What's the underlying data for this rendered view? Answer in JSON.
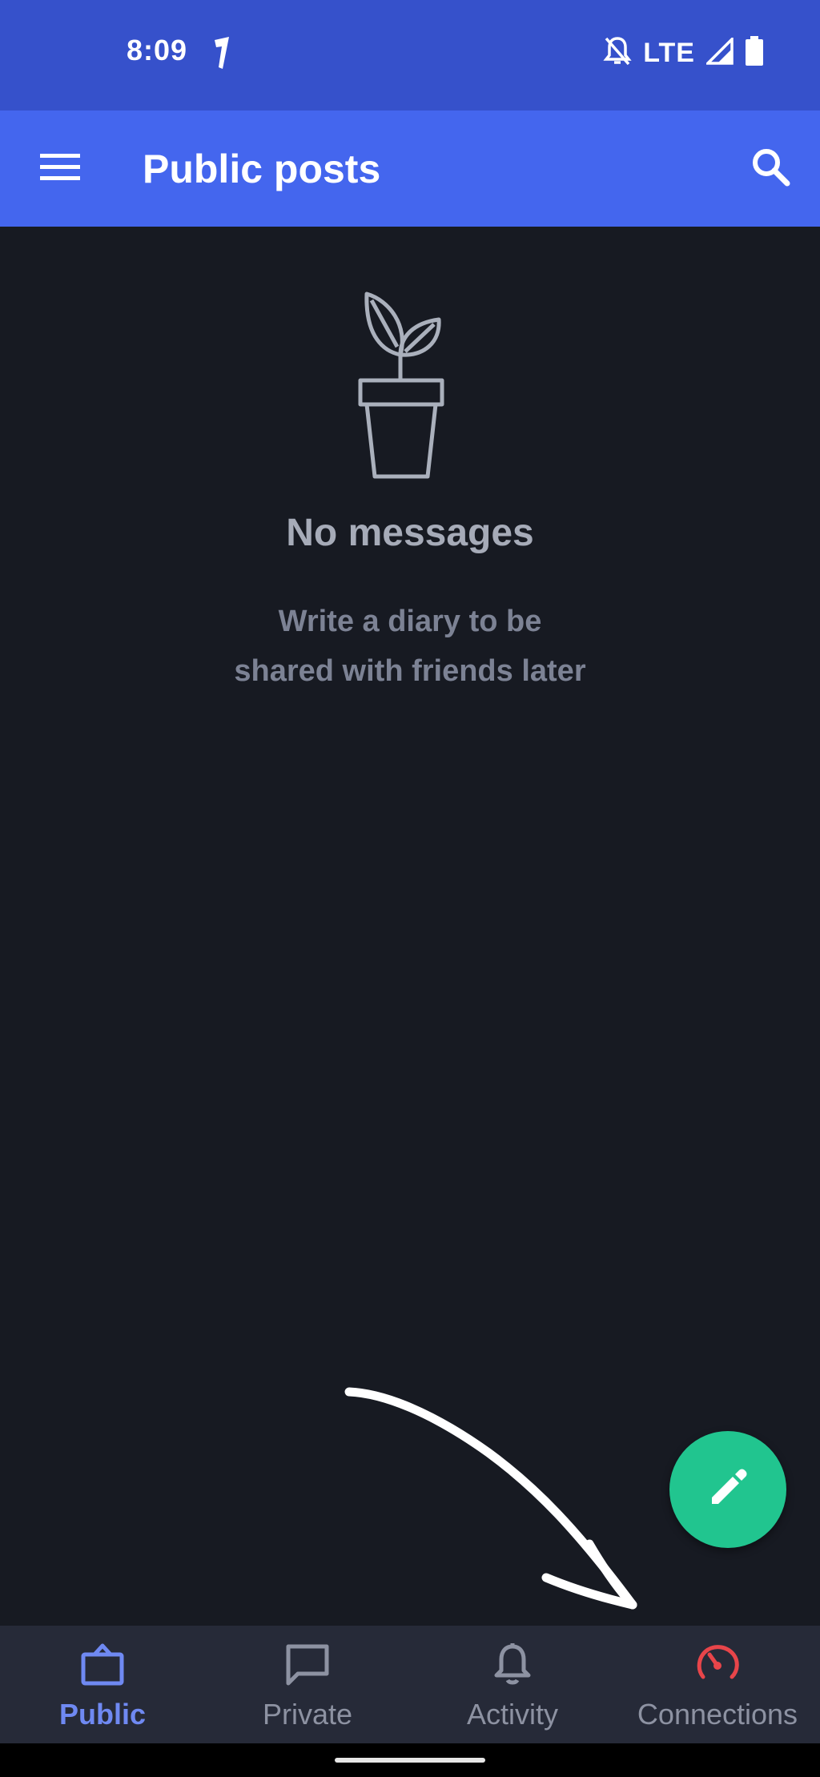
{
  "status_bar": {
    "time": "8:09",
    "network": "LTE",
    "icons": [
      "navigation-icon",
      "bell-off-icon",
      "signal-icon",
      "battery-icon"
    ]
  },
  "app_bar": {
    "title": "Public posts",
    "menu_icon": "menu-icon",
    "search_icon": "search-icon"
  },
  "empty_state": {
    "icon": "plant-pot-icon",
    "title": "No messages",
    "subtitle_line1": "Write a diary to be",
    "subtitle_line2": "shared with friends later"
  },
  "fab": {
    "icon": "pencil-icon",
    "color": "#21c58f"
  },
  "bottom_nav": {
    "items": [
      {
        "label": "Public",
        "icon": "shopping-bag-icon",
        "active": true
      },
      {
        "label": "Private",
        "icon": "chat-bubble-icon",
        "active": false
      },
      {
        "label": "Activity",
        "icon": "bell-icon",
        "active": false
      },
      {
        "label": "Connections",
        "icon": "speedometer-icon",
        "active": false
      }
    ]
  },
  "colors": {
    "status_bar": "#3651cb",
    "app_bar": "#4466ee",
    "background": "#171a22",
    "nav_background": "#262a38",
    "active_nav": "#6f89f2",
    "connections_icon": "#e8454a"
  }
}
